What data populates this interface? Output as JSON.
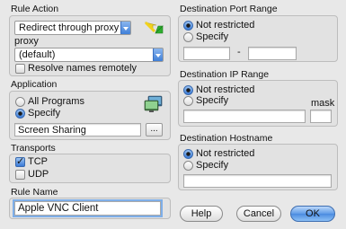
{
  "rule_action": {
    "title": "Rule Action",
    "action_value": "Redirect through proxy",
    "proxy_label": "proxy",
    "proxy_value": "(default)",
    "resolve_label": "Resolve names remotely",
    "resolve_checked": false
  },
  "application": {
    "title": "Application",
    "all_programs_label": "All Programs",
    "specify_label": "Specify",
    "selected": "Specify",
    "app_value": "Screen Sharing",
    "browse_label": "..."
  },
  "transports": {
    "title": "Transports",
    "tcp_label": "TCP",
    "tcp_checked": true,
    "udp_label": "UDP",
    "udp_checked": false
  },
  "rule_name": {
    "title": "Rule Name",
    "value": "Apple VNC Client"
  },
  "dest_port": {
    "title": "Destination Port Range",
    "not_restricted_label": "Not restricted",
    "specify_label": "Specify",
    "selected": "Not restricted",
    "range_separator": "-",
    "from_value": "",
    "to_value": ""
  },
  "dest_ip": {
    "title": "Destination IP Range",
    "not_restricted_label": "Not restricted",
    "specify_label": "Specify",
    "selected": "Not restricted",
    "mask_label": "mask",
    "ip_value": "",
    "mask_value": ""
  },
  "dest_host": {
    "title": "Destination Hostname",
    "not_restricted_label": "Not restricted",
    "specify_label": "Specify",
    "selected": "Not restricted",
    "host_value": ""
  },
  "buttons": {
    "help": "Help",
    "cancel": "Cancel",
    "ok": "OK"
  },
  "icons": {
    "action_icon": "arrows-redirect-icon",
    "app_icon": "screen-sharing-app-icon"
  },
  "colors": {
    "accent": "#3f7fd8",
    "redirect_yellow": "#f2d21b",
    "redirect_green": "#2fae2f"
  }
}
